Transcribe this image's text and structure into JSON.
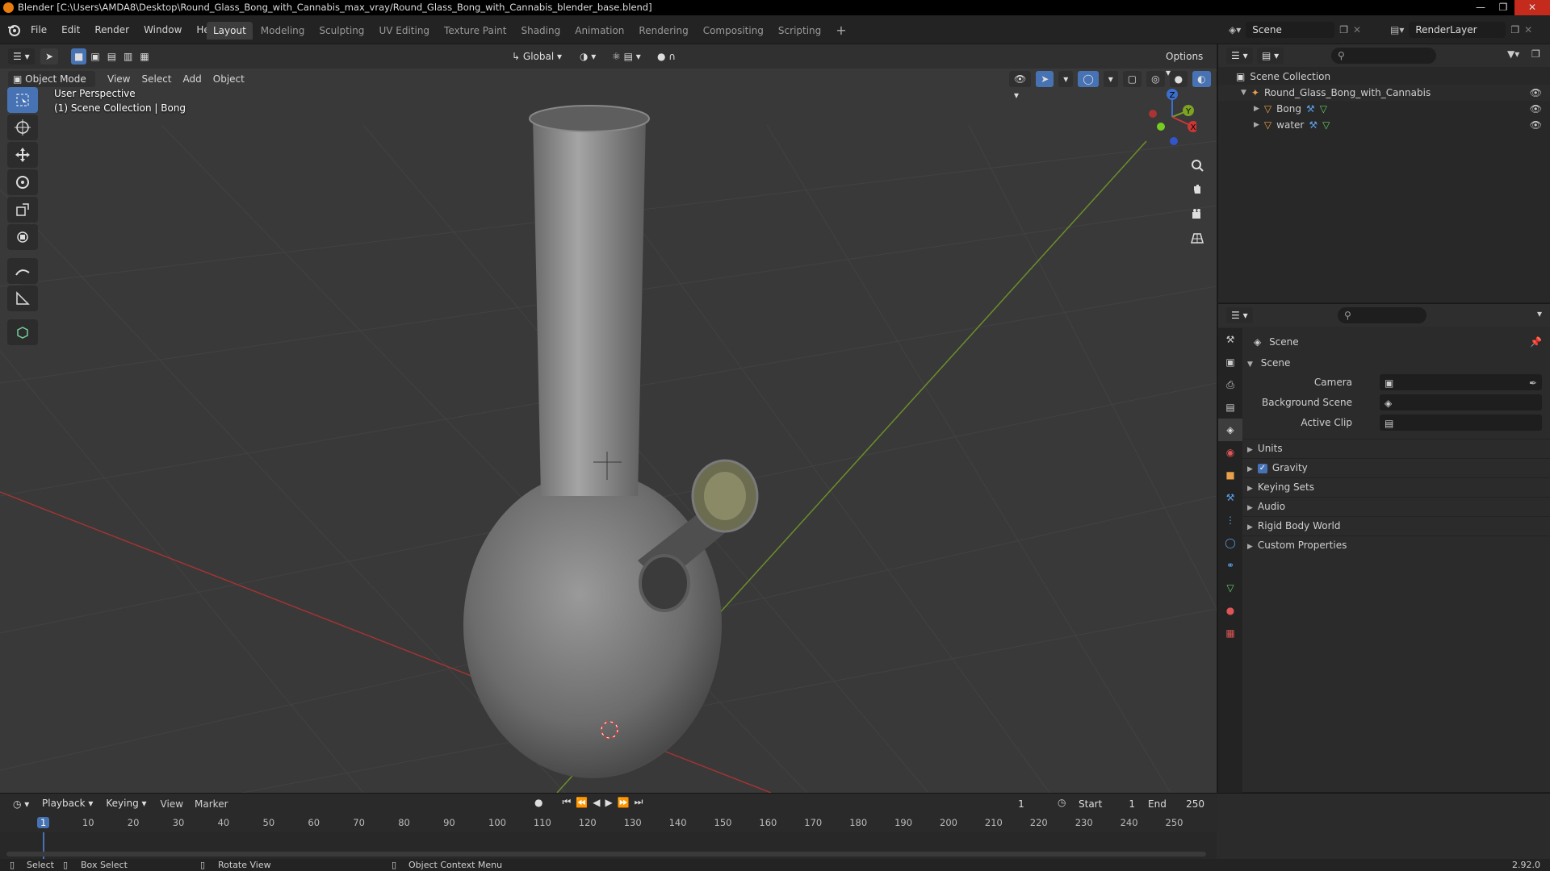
{
  "window": {
    "title": "Blender [C:\\Users\\AMDA8\\Desktop\\Round_Glass_Bong_with_Cannabis_max_vray/Round_Glass_Bong_with_Cannabis_blender_base.blend]"
  },
  "menu": [
    "File",
    "Edit",
    "Render",
    "Window",
    "Help"
  ],
  "workspaces": [
    "Layout",
    "Modeling",
    "Sculpting",
    "UV Editing",
    "Texture Paint",
    "Shading",
    "Animation",
    "Rendering",
    "Compositing",
    "Scripting"
  ],
  "active_workspace": "Layout",
  "scene_name": "Scene",
  "view_layer": "RenderLayer",
  "viewport": {
    "orientation": "Global",
    "options_label": "Options",
    "mode": "Object Mode",
    "menus": [
      "View",
      "Select",
      "Add",
      "Object"
    ],
    "overlay_line1": "User Perspective",
    "overlay_line2": "(1) Scene Collection | Bong",
    "gizmo_axes": {
      "x": "X",
      "y": "Y",
      "z": "Z"
    }
  },
  "outliner": {
    "root": "Scene Collection",
    "collection": "Round_Glass_Bong_with_Cannabis",
    "objects": [
      "Bong",
      "water"
    ]
  },
  "properties": {
    "title": "Scene",
    "panel": "Scene",
    "fields": [
      {
        "label": "Camera"
      },
      {
        "label": "Background Scene"
      },
      {
        "label": "Active Clip"
      }
    ],
    "sections": [
      "Units",
      "Gravity",
      "Keying Sets",
      "Audio",
      "Rigid Body World",
      "Custom Properties"
    ],
    "gravity_checked": true
  },
  "timeline": {
    "menus": [
      "Playback",
      "Keying",
      "View",
      "Marker"
    ],
    "current_frame": "1",
    "start_label": "Start",
    "start": "1",
    "end_label": "End",
    "end": "250",
    "ticks": [
      "1",
      "10",
      "20",
      "30",
      "40",
      "50",
      "60",
      "70",
      "80",
      "90",
      "100",
      "110",
      "120",
      "130",
      "140",
      "150",
      "160",
      "170",
      "180",
      "190",
      "200",
      "210",
      "220",
      "230",
      "240",
      "250"
    ]
  },
  "statusbar": {
    "select": "Select",
    "box_select": "Box Select",
    "rotate_view": "Rotate View",
    "context_menu": "Object Context Menu",
    "version": "2.92.0"
  },
  "colors": {
    "accent": "#4772b3",
    "x_axis": "#c93737",
    "y_axis": "#7da325",
    "z_axis": "#3c6fcc",
    "orange": "#e87d0d"
  }
}
